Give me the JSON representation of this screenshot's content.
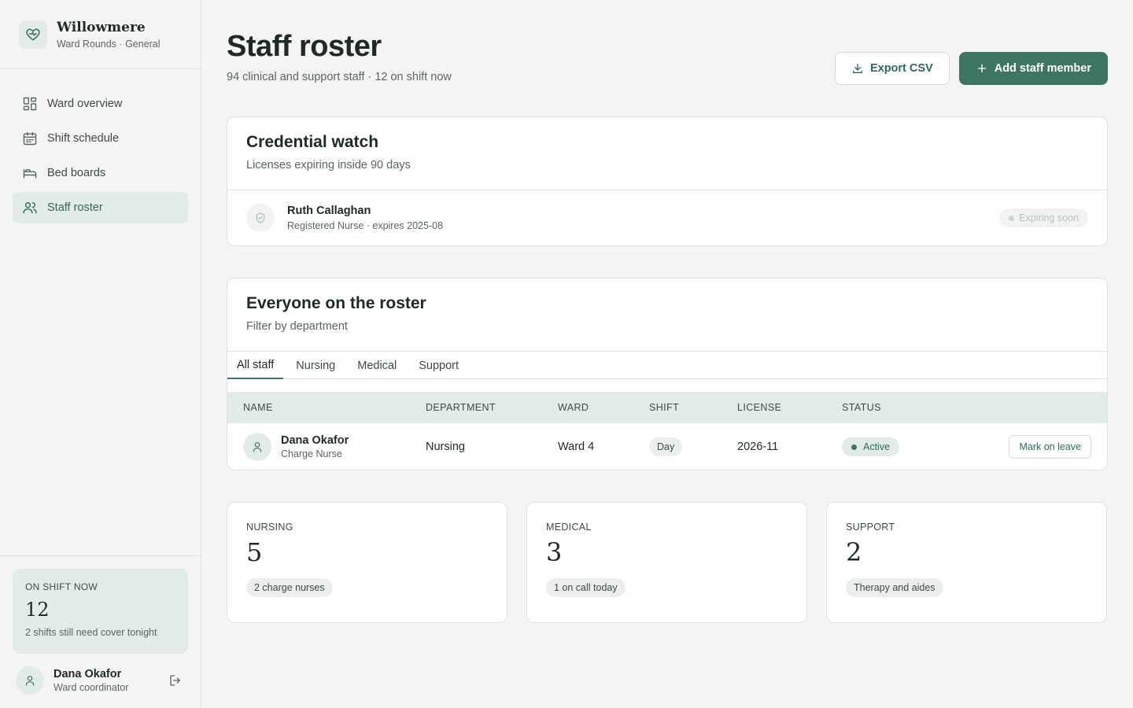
{
  "brand": {
    "name": "Willowmere",
    "subtitle": "Ward Rounds · General"
  },
  "nav": [
    {
      "label": "Ward overview",
      "icon": "grid-icon",
      "active": false
    },
    {
      "label": "Shift schedule",
      "icon": "calendar-icon",
      "active": false
    },
    {
      "label": "Bed boards",
      "icon": "bed-icon",
      "active": false
    },
    {
      "label": "Staff roster",
      "icon": "users-icon",
      "active": true
    }
  ],
  "on_shift": {
    "label": "ON SHIFT NOW",
    "count": "12",
    "note": "2 shifts still need cover tonight"
  },
  "user": {
    "name": "Dana Okafor",
    "role": "Ward coordinator"
  },
  "page": {
    "title": "Staff roster",
    "subtitle": "94 clinical and support staff · 12 on shift now",
    "export_label": "Export CSV",
    "add_label": "Add staff member"
  },
  "credential_watch": {
    "title": "Credential watch",
    "subtitle": "Licenses expiring inside 90 days",
    "items": [
      {
        "name": "Ruth Callaghan",
        "meta": "Registered Nurse · expires 2025-08",
        "badge": "Expiring soon"
      }
    ]
  },
  "roster": {
    "title": "Everyone on the roster",
    "subtitle": "Filter by department",
    "tabs": [
      {
        "label": "All staff",
        "active": true
      },
      {
        "label": "Nursing",
        "active": false
      },
      {
        "label": "Medical",
        "active": false
      },
      {
        "label": "Support",
        "active": false
      }
    ],
    "columns": [
      "NAME",
      "DEPARTMENT",
      "WARD",
      "SHIFT",
      "LICENSE",
      "STATUS"
    ],
    "rows": [
      {
        "name": "Dana Okafor",
        "role": "Charge Nurse",
        "department": "Nursing",
        "ward": "Ward 4",
        "shift": "Day",
        "license": "2026-11",
        "status": "Active",
        "action": "Mark on leave"
      }
    ]
  },
  "stats": [
    {
      "label": "NURSING",
      "value": "5",
      "tag": "2 charge nurses"
    },
    {
      "label": "MEDICAL",
      "value": "3",
      "tag": "1 on call today"
    },
    {
      "label": "SUPPORT",
      "value": "2",
      "tag": "Therapy and aides"
    }
  ],
  "colors": {
    "accent": "#3d7564",
    "accent_soft": "#e3ebe7",
    "background": "#f4f5f3"
  }
}
